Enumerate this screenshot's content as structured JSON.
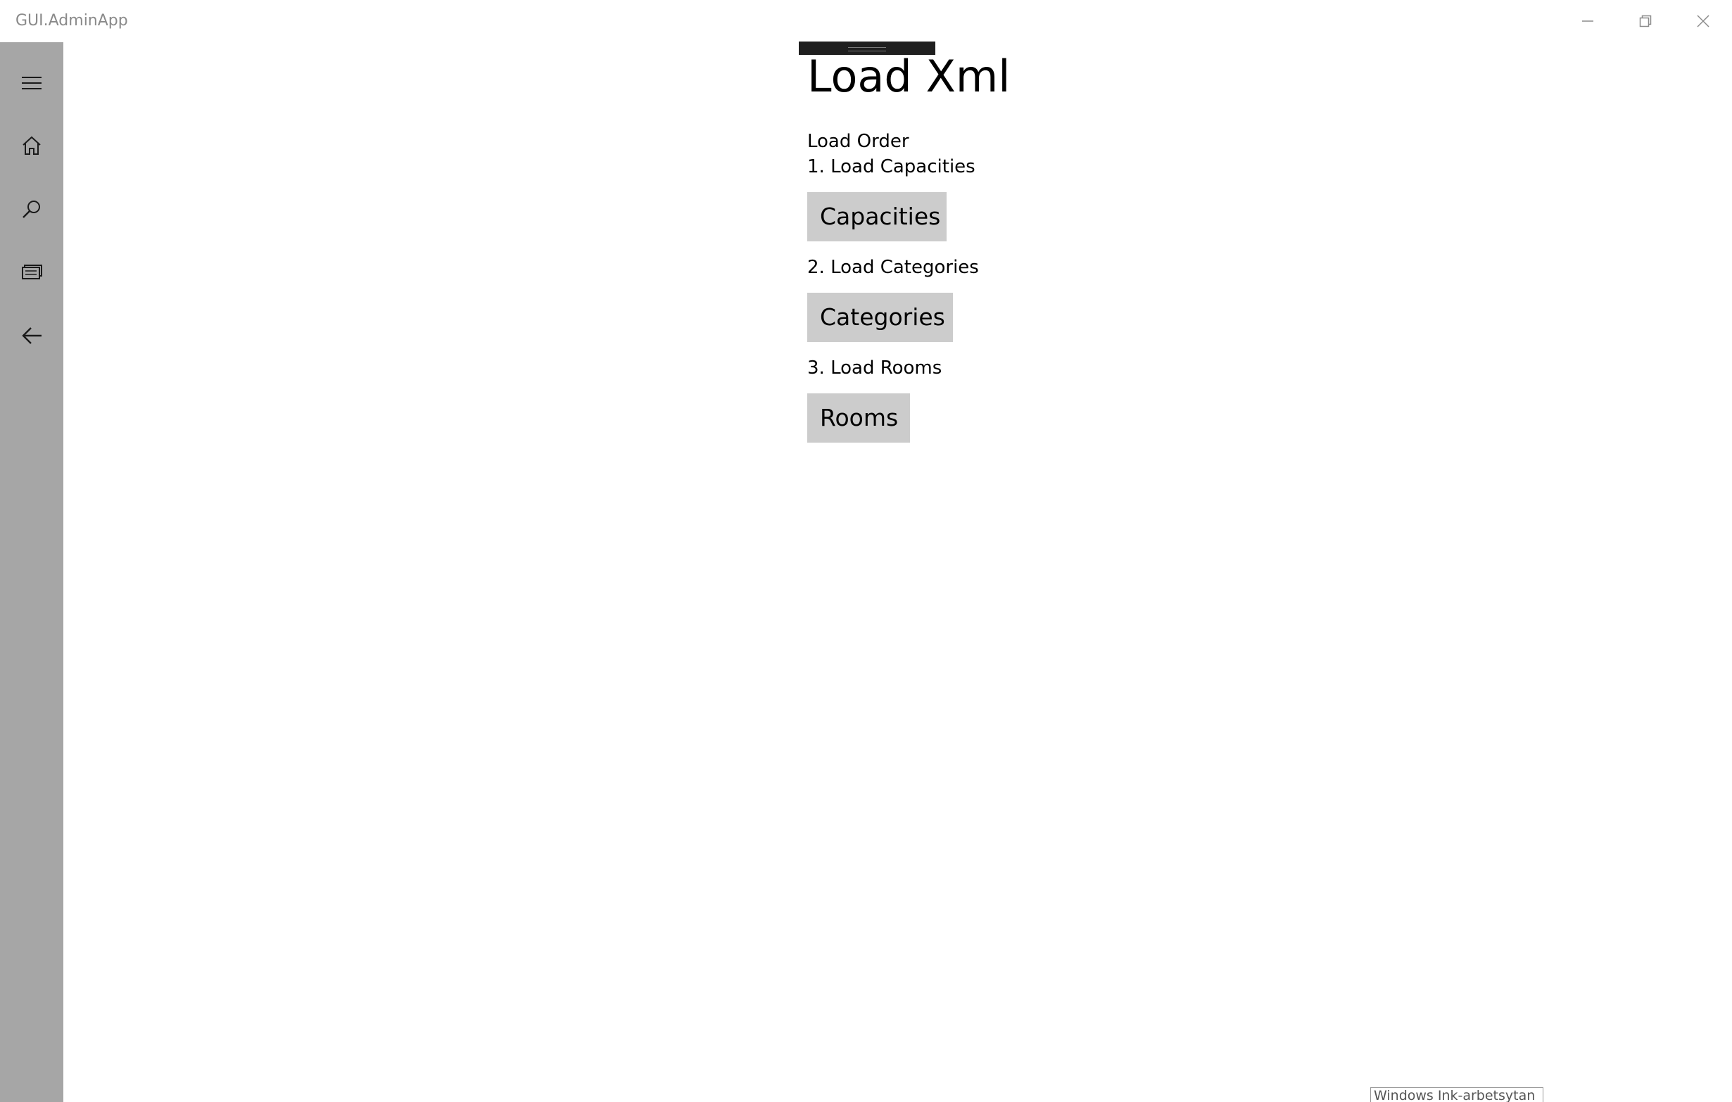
{
  "window": {
    "title": "GUI.AdminApp"
  },
  "caption_buttons": {
    "minimize_icon": "minimize-icon",
    "restore_icon": "restore-icon",
    "close_icon": "close-icon"
  },
  "sidebar": {
    "items": [
      {
        "icon": "hamburger-menu-icon"
      },
      {
        "icon": "home-icon"
      },
      {
        "icon": "search-icon"
      },
      {
        "icon": "list-icon"
      },
      {
        "icon": "back-arrow-icon"
      }
    ]
  },
  "page": {
    "title": "Load Xml",
    "load_order_label": "Load Order",
    "steps": [
      {
        "text": "1. Load Capacities",
        "button_label": "Capacities"
      },
      {
        "text": "2. Load Categories",
        "button_label": "Categories"
      },
      {
        "text": "3. Load Rooms",
        "button_label": "Rooms"
      }
    ]
  },
  "ink_tooltip": {
    "text": "Windows Ink-arbetsytan"
  },
  "colors": {
    "sidebar_bg": "#a6a6a6",
    "button_bg": "#cccccc",
    "title_text": "#8a8a8a",
    "drag_bar": "#1f1f1f"
  }
}
